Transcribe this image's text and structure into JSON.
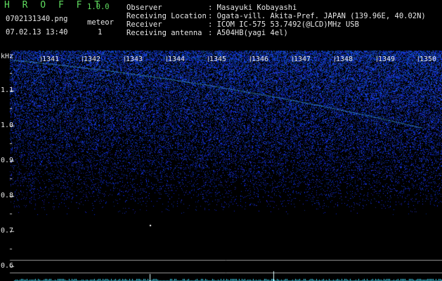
{
  "app": {
    "name": "H R O F F T",
    "version": "1.0.0"
  },
  "file": {
    "name": "0702131340.png",
    "datetime": "07.02.13 13:40"
  },
  "meteor": {
    "label": "meteor",
    "count": "1"
  },
  "info": {
    "observer_label": "Observer",
    "observer_value": ": Masayuki Kobayashi",
    "location_label": "Receiving Location",
    "location_value": ": Ogata-vill. Akita-Pref. JAPAN (139.96E, 40.02N)",
    "receiver_label": "Receiver",
    "receiver_value": ": ICOM IC-575 53.7492(@LCD)MHz USB",
    "antenna_label": "Receiving antenna",
    "antenna_value": ": A504HB(yagi 4el)"
  },
  "axis": {
    "unit": "kHz",
    "freq_ticks": [
      "1.1",
      "1.0",
      "0.9",
      "0.8",
      "0.7",
      "0.6"
    ],
    "minute_ticks": [
      "1341",
      "1342",
      "1343",
      "1344",
      "1345",
      "1346",
      "1347",
      "1348",
      "1349",
      "1350"
    ]
  },
  "colors": {
    "accent_green": "#5fdc5f",
    "noise_blue": "#2840ff",
    "trace_cyan": "#40e0ff"
  }
}
